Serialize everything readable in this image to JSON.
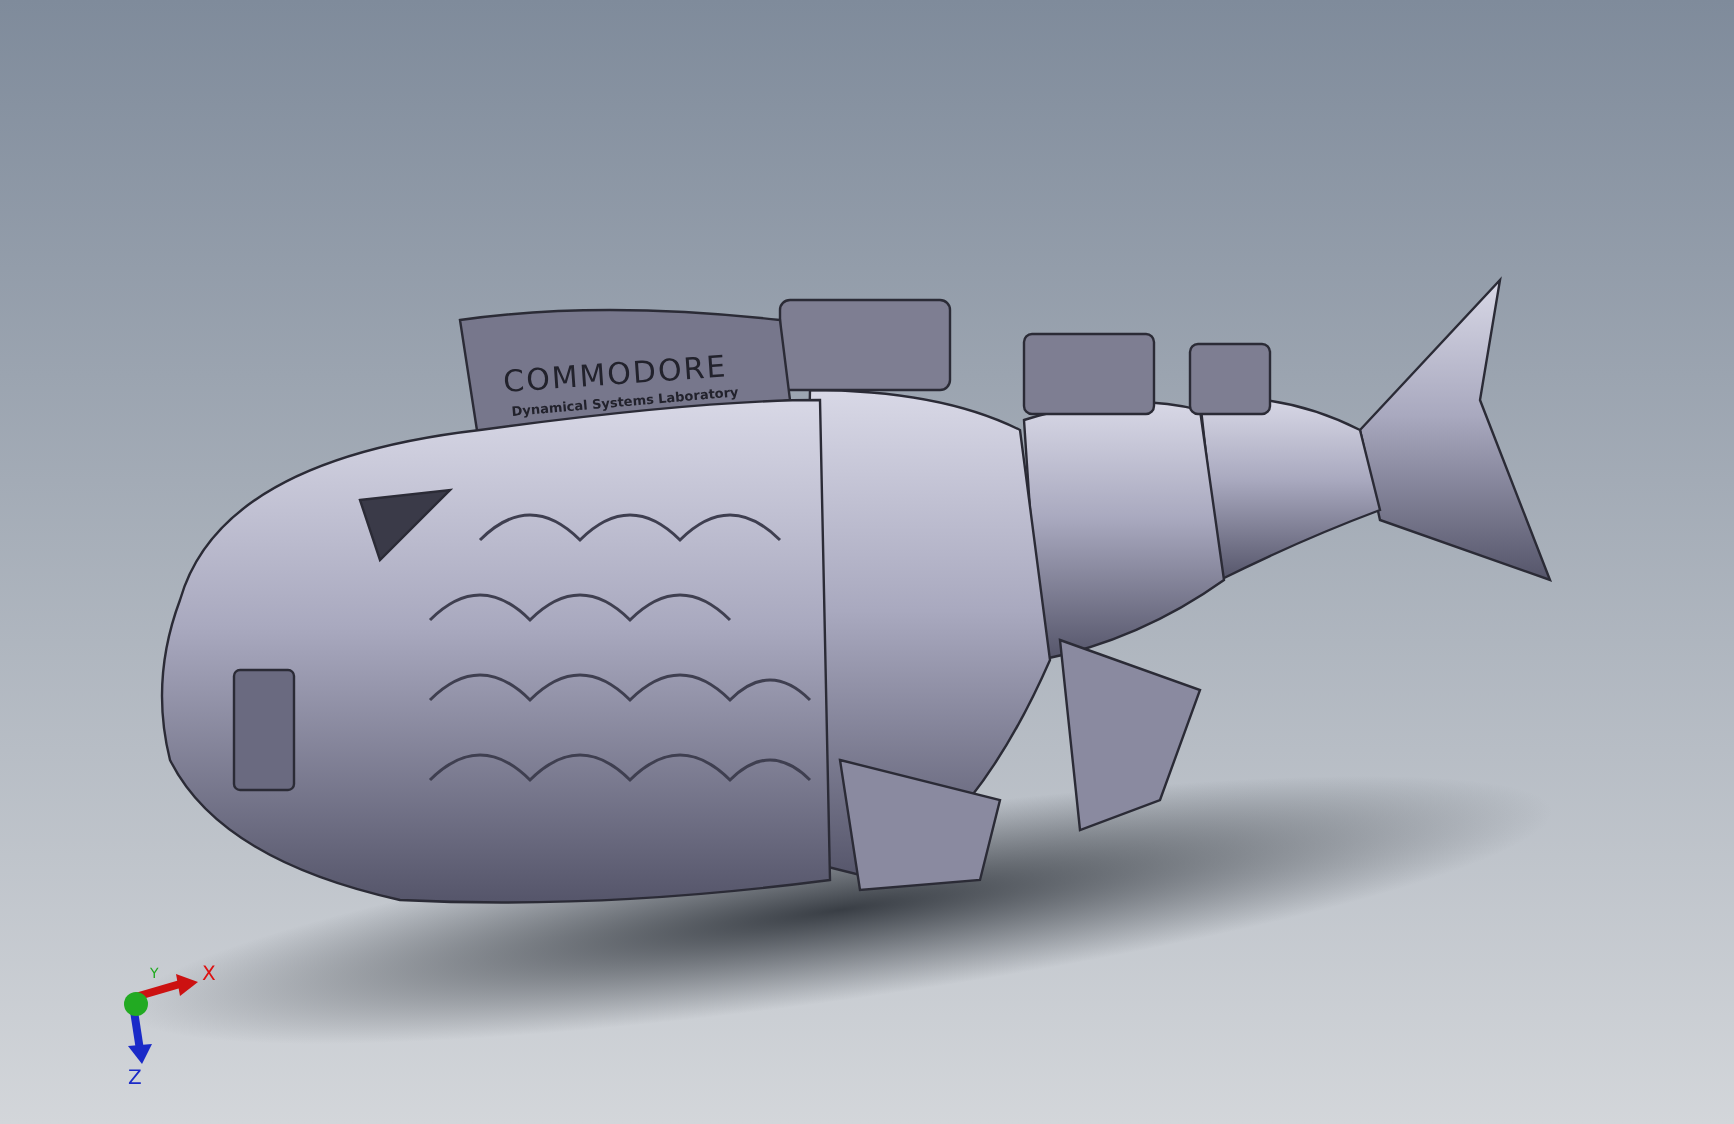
{
  "model": {
    "plate_lines": [
      "COMMODORE",
      "Dynamical Systems Laboratory"
    ]
  },
  "triad": {
    "axes": [
      "X",
      "Y",
      "Z"
    ]
  }
}
